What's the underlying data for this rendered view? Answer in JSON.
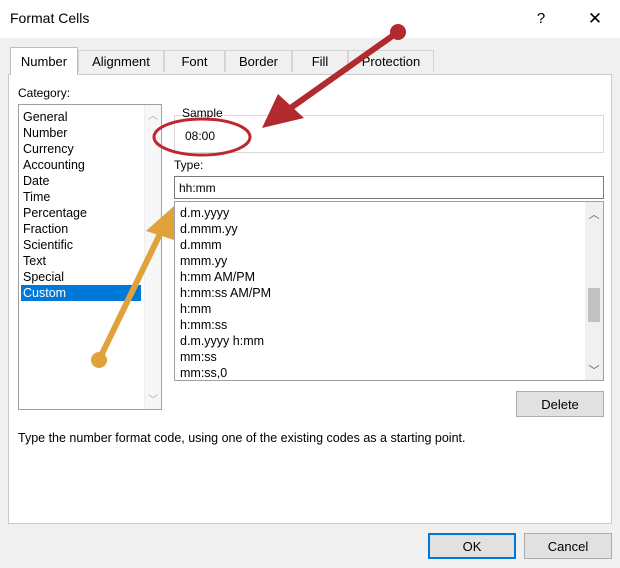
{
  "window": {
    "title": "Format Cells",
    "help": "?",
    "close": "✕"
  },
  "tabs": [
    {
      "label": "Number",
      "active": true
    },
    {
      "label": "Alignment",
      "active": false
    },
    {
      "label": "Font",
      "active": false
    },
    {
      "label": "Border",
      "active": false
    },
    {
      "label": "Fill",
      "active": false
    },
    {
      "label": "Protection",
      "active": false
    }
  ],
  "category": {
    "label": "Category:",
    "items": [
      "General",
      "Number",
      "Currency",
      "Accounting",
      "Date",
      "Time",
      "Percentage",
      "Fraction",
      "Scientific",
      "Text",
      "Special",
      "Custom"
    ],
    "selected": "Custom"
  },
  "sample": {
    "label": "Sample",
    "value": "08:00"
  },
  "type": {
    "label": "Type:",
    "value": "hh:mm",
    "formats": [
      "d.m.yyyy",
      "d.mmm.yy",
      "d.mmm",
      "mmm.yy",
      "h:mm AM/PM",
      "h:mm:ss AM/PM",
      "h:mm",
      "h:mm:ss",
      "d.m.yyyy h:mm",
      "mm:ss",
      "mm:ss,0"
    ]
  },
  "buttons": {
    "delete": "Delete",
    "ok": "OK",
    "cancel": "Cancel"
  },
  "description": "Type the number format code, using one of the existing codes as a starting point.",
  "colors": {
    "selection": "#0078d7",
    "annotation_red": "#c0272d",
    "annotation_gold": "#e0a23c"
  }
}
